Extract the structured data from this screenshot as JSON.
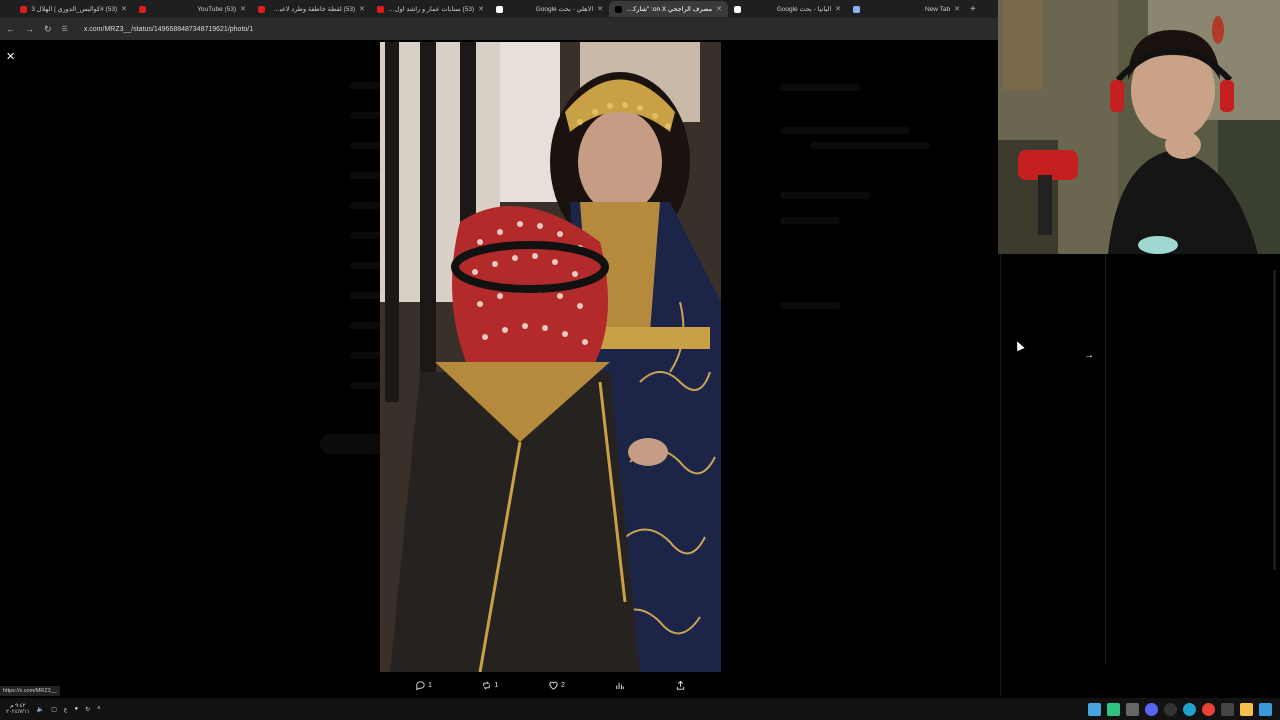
{
  "browser": {
    "tabs": [
      {
        "title": "(53) #كواليس_الدوري | الهلال 3",
        "fav_color": "#e01b1b"
      },
      {
        "title": "(53) YouTube",
        "fav_color": "#e01b1b"
      },
      {
        "title": "(53) لقطة خاطفة وطرد لاعبي الند...",
        "fav_color": "#e01b1b"
      },
      {
        "title": "(53) سنابات عمار و راشد اول مرة...",
        "fav_color": "#e01b1b"
      },
      {
        "title": "الاهلي - بحث Google",
        "fav_color": "#ffffff"
      },
      {
        "title": "مصرف الراجحي on X: \"شاركنا بد",
        "fav_color": "#000000",
        "active": true
      },
      {
        "title": "اليانيا - بحث Google",
        "fav_color": "#ffffff"
      },
      {
        "title": "New Tab",
        "fav_color": "#8ab4f8"
      }
    ],
    "url": "x.com/MRZ3__/status/1496688487348719621/photo/1"
  },
  "post_actions": {
    "replies": "1",
    "reposts": "1",
    "likes": "2"
  },
  "status_link": "https://x.com/MRZ3__",
  "taskbar": {
    "time": "٩:٤٢ م",
    "date": "٢٠٢٤/٧/١١",
    "lang": "ع"
  }
}
